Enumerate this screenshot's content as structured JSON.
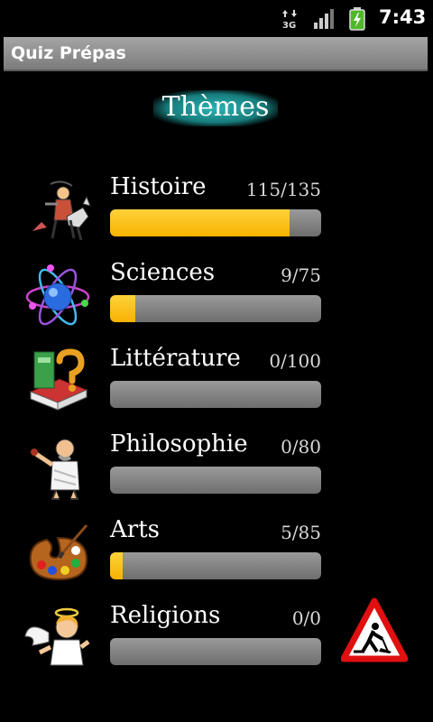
{
  "statusbar": {
    "network_icon": "3g-icon",
    "signal_icon": "signal-icon",
    "battery_icon": "battery-charging-icon",
    "time": "7:43"
  },
  "app": {
    "title": "Quiz Prépas"
  },
  "header": {
    "title": "Thèmes"
  },
  "colors": {
    "progress_fill": "#f7b200",
    "progress_track": "#808080",
    "header_glow": "#2ab5b5"
  },
  "themes": [
    {
      "label": "Histoire",
      "score": "115/135",
      "done": 115,
      "total": 135,
      "icon": "history-knight-icon"
    },
    {
      "label": "Sciences",
      "score": "9/75",
      "done": 9,
      "total": 75,
      "icon": "atom-icon"
    },
    {
      "label": "Littérature",
      "score": "0/100",
      "done": 0,
      "total": 100,
      "icon": "book-question-icon"
    },
    {
      "label": "Philosophie",
      "score": "0/80",
      "done": 0,
      "total": 80,
      "icon": "philosopher-icon"
    },
    {
      "label": "Arts",
      "score": "5/85",
      "done": 5,
      "total": 85,
      "icon": "palette-icon"
    },
    {
      "label": "Religions",
      "score": "0/0",
      "done": 0,
      "total": 0,
      "icon": "angel-icon"
    }
  ],
  "construction_icon": "under-construction-icon"
}
